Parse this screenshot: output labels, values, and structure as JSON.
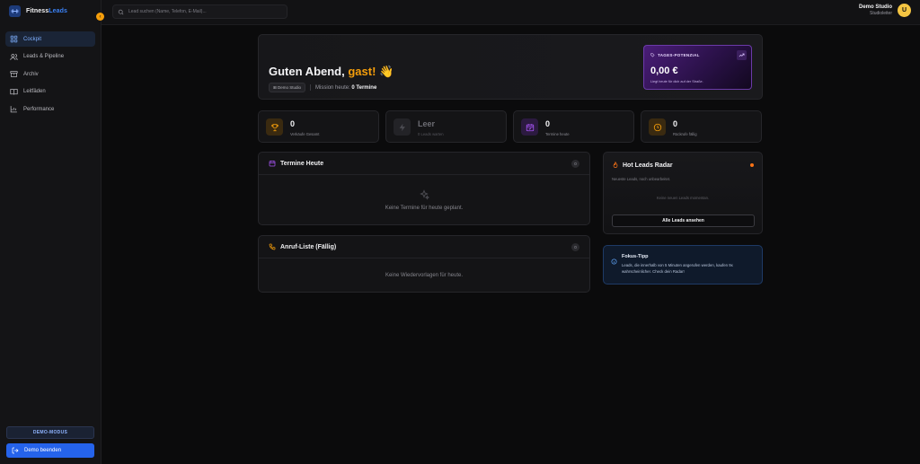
{
  "brand": {
    "part1": "Fitness",
    "part2": "Leads"
  },
  "sidebar": {
    "items": [
      {
        "label": "Cockpit",
        "icon": "grid-icon",
        "active": true
      },
      {
        "label": "Leads & Pipeline",
        "icon": "users-icon",
        "active": false
      },
      {
        "label": "Archiv",
        "icon": "archive-icon",
        "active": false
      },
      {
        "label": "Leitfäden",
        "icon": "book-icon",
        "active": false
      },
      {
        "label": "Performance",
        "icon": "chart-icon",
        "active": false
      }
    ],
    "demo_mode": "DEMO-MODUS",
    "demo_end": "Demo beenden"
  },
  "search": {
    "placeholder": "Lead suchen (Name, Telefon, E-Mail)..."
  },
  "user": {
    "name": "Demo Studio",
    "role": "Studioleiter",
    "initial": "U"
  },
  "hero": {
    "greeting": "Guten Abend, ",
    "name": "gast!",
    "emoji": "👋",
    "studio_chip": "⊞ Demo Studio",
    "mission_label": "Mission heute:",
    "mission_value": "0 Termine",
    "potential": {
      "label": "TAGES-POTENZIAL",
      "value": "0,00 €",
      "sub": "Liegt heute für dich auf der Straße."
    }
  },
  "stats": [
    {
      "value": "0",
      "label": "Verkäufe Gesamt",
      "icon": "trophy-icon",
      "color": "#f59e0b",
      "bg": "#3a2a10",
      "dim": false
    },
    {
      "value": "Leer",
      "label": "0 Leads warten",
      "icon": "bolt-icon",
      "color": "#4b4b52",
      "bg": "#232327",
      "dim": true
    },
    {
      "value": "0",
      "label": "Termine heute",
      "icon": "calendar-icon",
      "color": "#a855f7",
      "bg": "#2c1a40",
      "dim": false
    },
    {
      "value": "0",
      "label": "Rückrufe fällig",
      "icon": "clock-icon",
      "color": "#f59e0b",
      "bg": "#3a2a10",
      "dim": false
    }
  ],
  "termine": {
    "title": "Termine Heute",
    "count": "0",
    "empty": "Keine Termine für heute geplant."
  },
  "anrufe": {
    "title": "Anruf-Liste (Fällig)",
    "count": "0",
    "empty": "Keine Wiedervorlagen für heute."
  },
  "hot": {
    "title": "Hot Leads Radar",
    "sub": "Neueste Leads, noch unbearbeitet.",
    "empty": "Keine neuen Leads momentan.",
    "button": "Alle Leads ansehen"
  },
  "tip": {
    "title": "Fokus-Tipp",
    "text": "Leads, die innerhalb von 5 Minuten angerufen werden, kaufen 9x wahrscheinlicher. Check dein Radar!"
  },
  "colors": {
    "accent": "#3b82f6",
    "orange": "#f59e0b",
    "purple": "#a855f7"
  }
}
